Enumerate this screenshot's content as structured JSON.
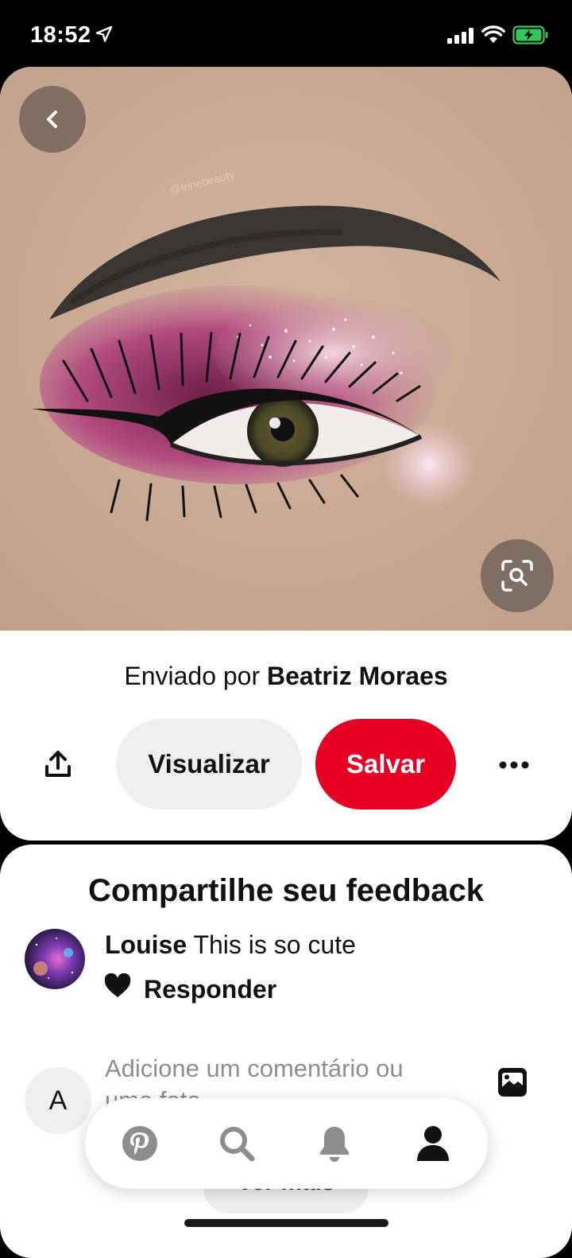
{
  "status_bar": {
    "time": "18:52",
    "icons": [
      "location-arrow-icon",
      "cellular-signal-icon",
      "wifi-icon",
      "battery-charging-icon"
    ],
    "battery_color": "#34c759"
  },
  "pin": {
    "image_description_icon": "eye-makeup-photo",
    "sent_by_prefix": "Enviado por",
    "author": "Beatriz Moraes",
    "view_label": "Visualizar",
    "save_label": "Salvar",
    "save_color": "#e60023",
    "icons": [
      "chevron-left-icon",
      "visual-search-icon",
      "share-icon",
      "more-icon"
    ]
  },
  "comments": {
    "title": "Compartilhe seu feedback",
    "items": [
      {
        "author": "Louise",
        "text": "This is so cute",
        "reply_label": "Responder"
      }
    ],
    "my_avatar_letter": "A",
    "input_placeholder": "Adicione um comentário ou uma foto",
    "see_more_label": "Ver mais"
  },
  "tab_bar": {
    "tabs": [
      "home-pinterest-icon",
      "search-icon",
      "notifications-bell-icon",
      "profile-icon"
    ]
  }
}
